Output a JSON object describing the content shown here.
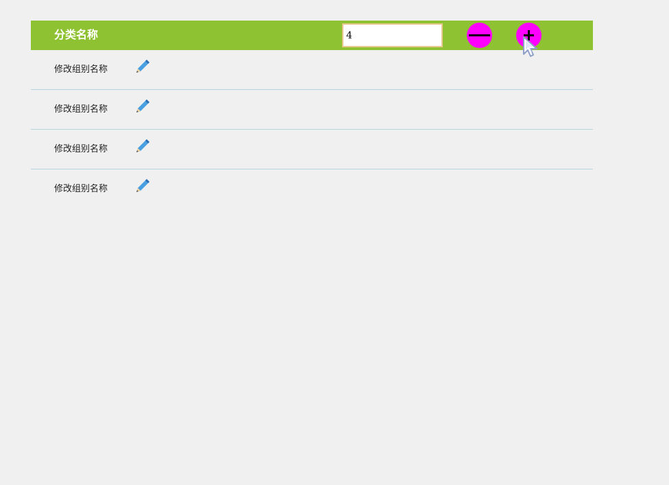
{
  "header": {
    "title": "分类名称",
    "count_value": "4",
    "minus_icon": "minus-circle-icon",
    "plus_icon": "plus-circle-icon"
  },
  "groups": [
    {
      "label": "修改组别名称",
      "icon": "pencil-icon"
    },
    {
      "label": "修改组别名称",
      "icon": "pencil-icon"
    },
    {
      "label": "修改组别名称",
      "icon": "pencil-icon"
    },
    {
      "label": "修改组别名称",
      "icon": "pencil-icon"
    }
  ],
  "colors": {
    "header_bg": "#8fc232",
    "button_fill": "#ff00ff",
    "row_divider": "#b7d3dc",
    "page_bg": "#f0f0f0"
  }
}
